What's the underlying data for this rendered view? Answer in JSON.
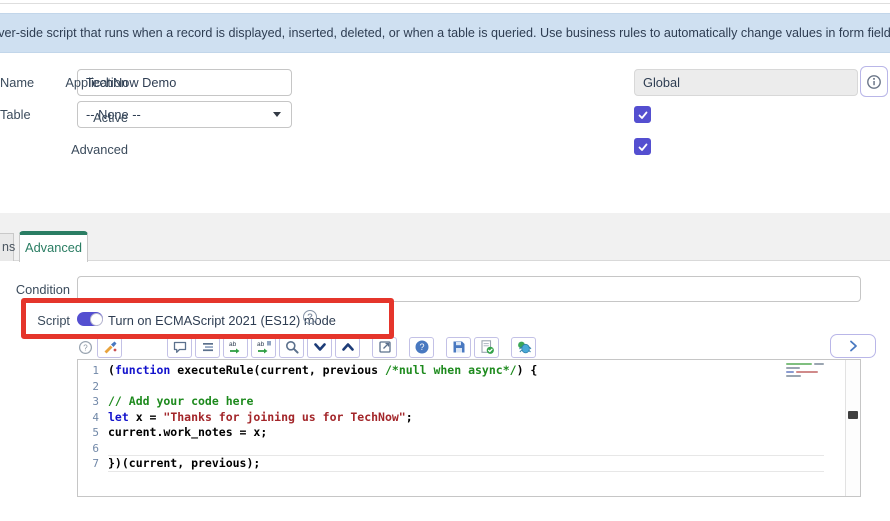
{
  "banner": {
    "text": "rver-side script that runs when a record is displayed, inserted, deleted, or when a table is queried. Use business rules to automatically change values in form fields when the specifie"
  },
  "form": {
    "name": {
      "label": "Name",
      "value": "TechNow Demo"
    },
    "table": {
      "label": "Table",
      "value": "-- None --"
    },
    "application": {
      "label": "Application",
      "value": "Global"
    },
    "active": {
      "label": "Active",
      "checked": true
    },
    "advanced": {
      "label": "Advanced",
      "checked": true
    }
  },
  "tabs": {
    "partial_label": "ns",
    "active_label": "Advanced"
  },
  "condition": {
    "label": "Condition",
    "value": ""
  },
  "script_row": {
    "label": "Script",
    "toggle_on": true,
    "toggle_label": "Turn on ECMAScript 2021 (ES12) mode"
  },
  "editor": {
    "toolbar": [
      {
        "name": "editor-help-icon",
        "glyph": "help-outline",
        "plain": true
      },
      {
        "name": "format-code-icon",
        "glyph": "format-brush"
      },
      {
        "name": "toggle-comment-icon",
        "glyph": "comment-bubble",
        "gap": "big"
      },
      {
        "name": "format-lines-icon",
        "glyph": "text-lines"
      },
      {
        "name": "replace-icon",
        "glyph": "replace"
      },
      {
        "name": "replace-all-icon",
        "glyph": "replace-all"
      },
      {
        "name": "search-icon",
        "glyph": "magnifier"
      },
      {
        "name": "find-next-icon",
        "glyph": "chevron-down"
      },
      {
        "name": "find-previous-icon",
        "glyph": "chevron-up"
      },
      {
        "name": "open-in-new-window-icon",
        "glyph": "popout",
        "gap": "sm"
      },
      {
        "name": "api-help-icon",
        "glyph": "help-filled",
        "gap": "sm"
      },
      {
        "name": "save-icon",
        "glyph": "floppy",
        "gap": "sm"
      },
      {
        "name": "syntax-check-icon",
        "glyph": "page-check"
      },
      {
        "name": "script-debugger-icon",
        "glyph": "bug",
        "gap": "sm"
      }
    ],
    "lines": [
      {
        "num": 1,
        "segments": [
          {
            "t": "p",
            "s": "("
          },
          {
            "t": "k",
            "s": "function"
          },
          {
            "t": "p",
            "s": " "
          },
          {
            "t": "d",
            "s": "executeRule"
          },
          {
            "t": "p",
            "s": "(current, previous "
          },
          {
            "t": "c",
            "s": "/*null when async*/"
          },
          {
            "t": "p",
            "s": ") {"
          }
        ]
      },
      {
        "num": 2,
        "segments": []
      },
      {
        "num": 3,
        "segments": [
          {
            "t": "c",
            "s": "// Add your code here"
          }
        ]
      },
      {
        "num": 4,
        "segments": [
          {
            "t": "k",
            "s": "let"
          },
          {
            "t": "p",
            "s": " x = "
          },
          {
            "t": "s",
            "s": "\"Thanks for joining us for TechNow\""
          },
          {
            "t": "p",
            "s": ";"
          }
        ]
      },
      {
        "num": 5,
        "segments": [
          {
            "t": "p",
            "s": "current.work_notes = x;"
          }
        ]
      },
      {
        "num": 6,
        "segments": [],
        "rule": true
      },
      {
        "num": 7,
        "segments": [
          {
            "t": "p",
            "s": "})(current, previous);"
          }
        ],
        "rule": true
      }
    ]
  },
  "colors": {
    "accent_purple": "#544fd0",
    "tab_green": "#2a7d63",
    "highlight_red": "#e5352b",
    "banner_blue": "#cfe0f1",
    "keyword_blue": "#1212cc",
    "comment_green": "#1d8a1d",
    "string_red": "#a3262a"
  }
}
